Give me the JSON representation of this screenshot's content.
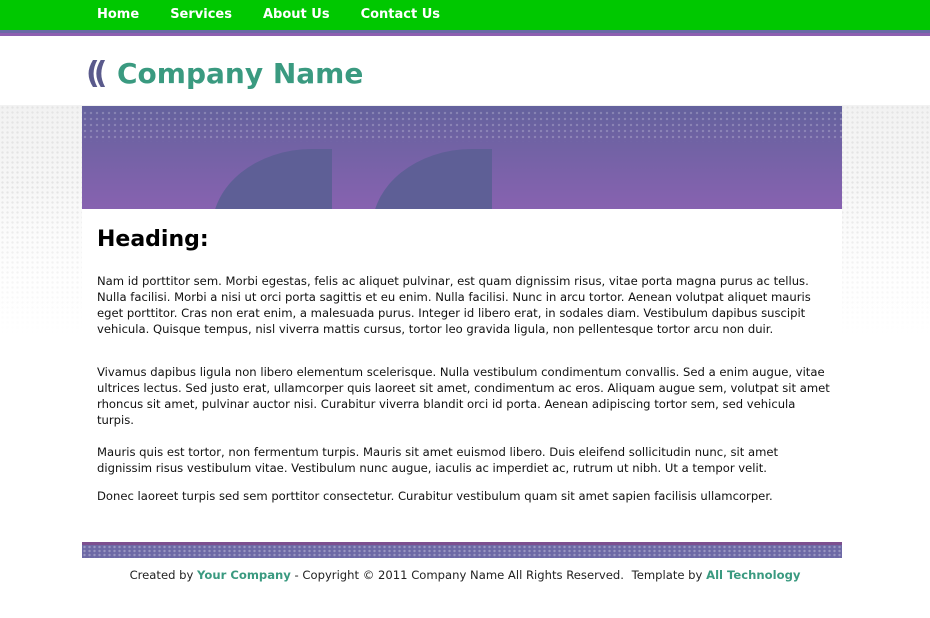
{
  "nav": {
    "items": [
      "Home",
      "Services",
      "About Us",
      "Contact Us"
    ]
  },
  "logo": {
    "marks": "((",
    "company_name": "Company Name"
  },
  "main": {
    "heading": "Heading:",
    "paragraphs": [
      "Nam id porttitor sem. Morbi egestas, felis ac aliquet pulvinar, est quam dignissim risus, vitae porta magna purus ac tellus. Nulla facilisi. Morbi a nisi ut orci porta sagittis et eu enim. Nulla facilisi. Nunc in arcu tortor. Aenean volutpat aliquet mauris eget porttitor. Cras non erat enim, a malesuada purus. Integer id libero erat, in sodales diam. Vestibulum dapibus suscipit vehicula. Quisque tempus, nisl viverra mattis cursus, tortor leo gravida ligula, non pellentesque tortor arcu non duir.",
      "Vivamus dapibus ligula non libero elementum scelerisque. Nulla vestibulum condimentum convallis. Sed a enim augue, vitae ultrices lectus. Sed justo erat, ullamcorper quis laoreet sit amet, condimentum ac eros. Aliquam augue sem, volutpat sit amet rhoncus sit amet, pulvinar auctor nisi. Curabitur viverra blandit orci id porta. Aenean adipiscing tortor sem, sed vehicula turpis.",
      "Mauris quis est tortor, non fermentum turpis. Mauris sit amet euismod libero. Duis eleifend sollicitudin nunc, sit amet dignissim risus vestibulum vitae. Vestibulum nunc augue, iaculis ac imperdiet ac, rutrum ut nibh. Ut a tempor velit.",
      "Donec laoreet turpis sed sem porttitor consectetur. Curabitur vestibulum quam sit amet sapien facilisis ullamcorper."
    ]
  },
  "footer": {
    "created_by": "Created by",
    "author_link": "Your Company",
    "copyright": "- Copyright © 2011 Company Name All Rights Reserved.",
    "template_by": "Template by",
    "template_link": "All Technology"
  },
  "colors": {
    "nav_bg": "#00c800",
    "brand_text": "#3a9a80",
    "banner_top": "#64629d",
    "banner_bottom": "#8762b0"
  }
}
